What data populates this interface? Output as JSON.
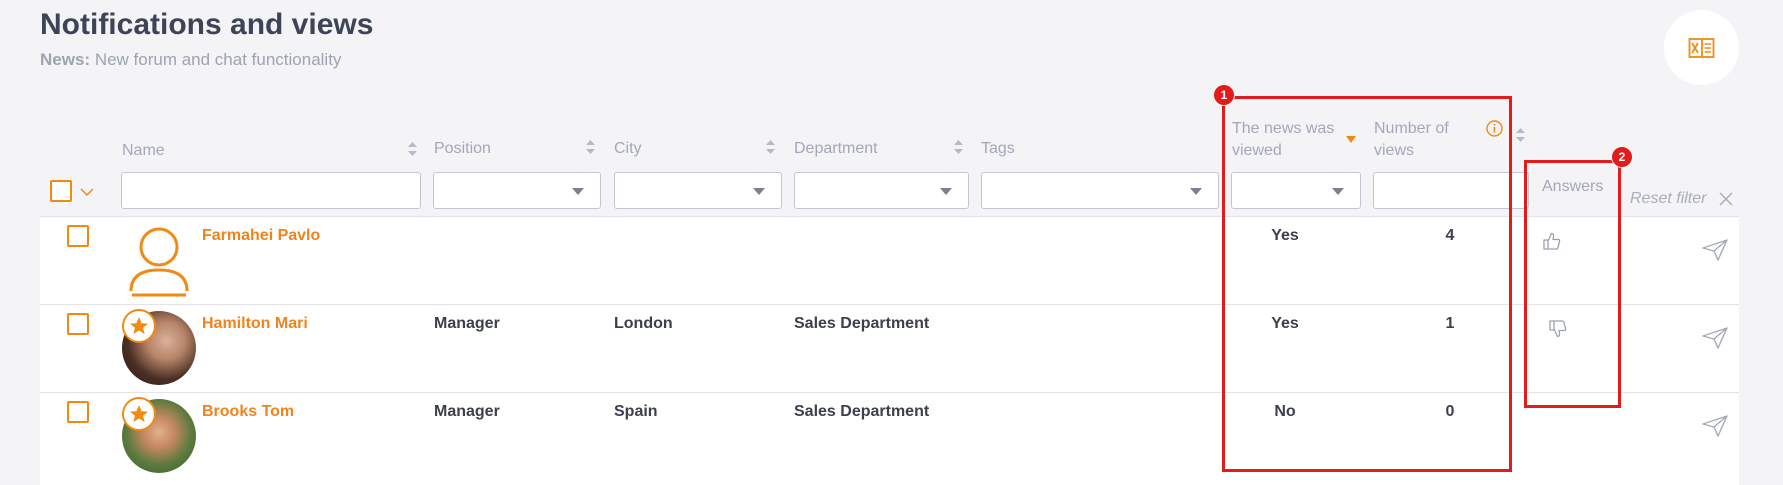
{
  "page": {
    "title": "Notifications and views",
    "subtitle_label": "News:",
    "subtitle_text": "New forum and chat functionality"
  },
  "toolbar": {
    "export_icon": "excel-export-icon"
  },
  "columns": {
    "name": "Name",
    "position": "Position",
    "city": "City",
    "department": "Department",
    "tags": "Tags",
    "viewed_line1": "The news was",
    "viewed_line2": "viewed",
    "views_line1": "Number of",
    "views_line2": "views",
    "answers": "Answers",
    "reset_filter": "Reset filter"
  },
  "rows": [
    {
      "name": "Farmahei Pavlo",
      "position": "",
      "city": "",
      "department": "",
      "viewed": "Yes",
      "views": "4",
      "answer": "thumbs-up-icon"
    },
    {
      "name": "Hamilton Mari",
      "position": "Manager",
      "city": "London",
      "department": "Sales Department",
      "viewed": "Yes",
      "views": "1",
      "answer": "thumbs-down-icon"
    },
    {
      "name": "Brooks Tom",
      "position": "Manager",
      "city": "Spain",
      "department": "Sales Department",
      "viewed": "No",
      "views": "0",
      "answer": ""
    }
  ],
  "annotations": {
    "marker1": "1",
    "marker2": "2"
  },
  "colors": {
    "accent": "#f08a13",
    "highlight": "#e31b1b",
    "text": "#3c3f4d",
    "muted": "#a3a7b8"
  }
}
